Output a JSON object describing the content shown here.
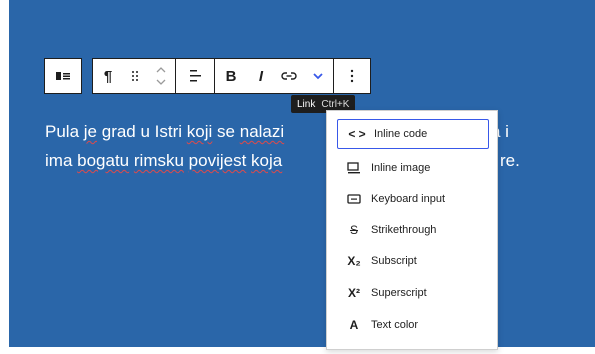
{
  "toolbar": {
    "block_type_icon": "columns-icon",
    "paragraph_icon": "pilcrow-icon",
    "drag_icon": "drag-handle-icon",
    "align_icon": "align-icon",
    "bold_label": "B",
    "italic_label": "I",
    "link_icon": "link-icon",
    "more_icon": "chevron-down-icon",
    "options_icon": "more-vertical-icon"
  },
  "tooltip": {
    "label": "Link",
    "shortcut": "Ctrl+K"
  },
  "paragraph": {
    "line1_a": "Pula",
    "line1_b": "je",
    "line1_c": "grad u Istri",
    "line1_d": "koji",
    "line1_e": "se",
    "line1_f": "nalazi",
    "line1_tail": "a i",
    "line2_a": "ima",
    "line2_b": "bogatu",
    "line2_c": "rimsku",
    "line2_d": "povijest",
    "line2_e": "koja",
    "line2_tail": "re."
  },
  "menu": {
    "items": [
      {
        "label": "Inline code",
        "glyph": "< >",
        "icon": "code-icon"
      },
      {
        "label": "Inline image",
        "glyph": "▭",
        "icon": "image-icon"
      },
      {
        "label": "Keyboard input",
        "glyph": "⌨",
        "icon": "keyboard-icon"
      },
      {
        "label": "Strikethrough",
        "glyph": "S",
        "icon": "strikethrough-icon"
      },
      {
        "label": "Subscript",
        "glyph": "X₂",
        "icon": "subscript-icon"
      },
      {
        "label": "Superscript",
        "glyph": "X²",
        "icon": "superscript-icon"
      },
      {
        "label": "Text color",
        "glyph": "A",
        "icon": "text-color-icon"
      }
    ]
  },
  "colors": {
    "canvas": "#2a66a9",
    "accent": "#3858e9",
    "squiggle": "#e04a4a"
  }
}
